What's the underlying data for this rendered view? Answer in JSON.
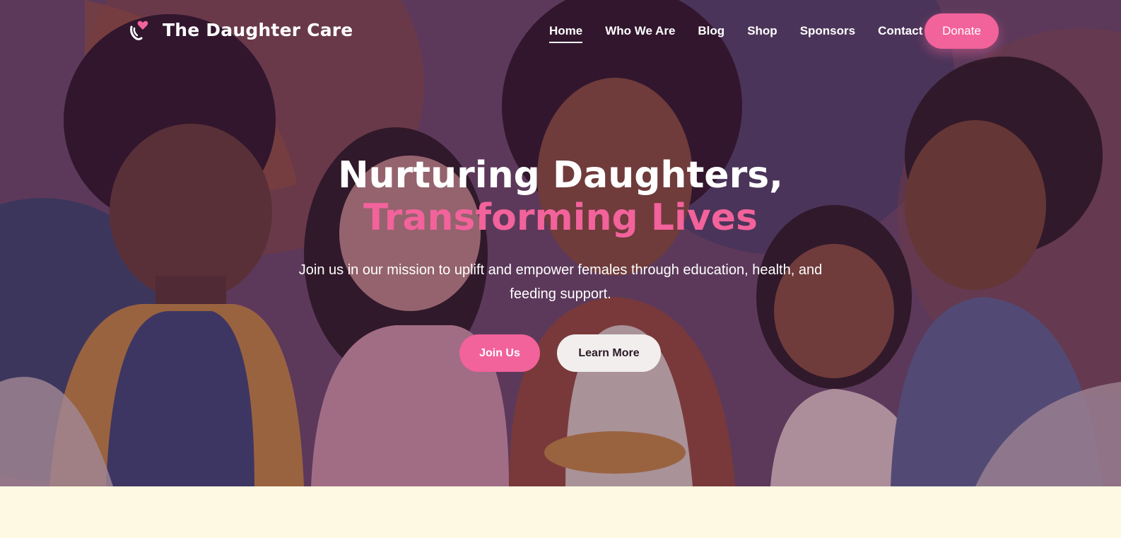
{
  "brand": {
    "name": "The Daughter Care",
    "icon": "hands-heart-icon"
  },
  "nav": {
    "items": [
      {
        "label": "Home",
        "active": true
      },
      {
        "label": "Who We Are",
        "active": false
      },
      {
        "label": "Blog",
        "active": false
      },
      {
        "label": "Shop",
        "active": false
      },
      {
        "label": "Sponsors",
        "active": false
      },
      {
        "label": "Contact",
        "active": false
      }
    ],
    "donate_label": "Donate"
  },
  "hero": {
    "title_line1": "Nurturing Daughters,",
    "title_line2": "Transforming Lives",
    "subtitle": "Join us in our mission to uplift and empower females through education, health, and feeding support.",
    "primary_button": "Join Us",
    "secondary_button": "Learn More"
  },
  "colors": {
    "accent": "#f2629b",
    "light_button": "#f2eeee",
    "section_bg": "#fdf8e1"
  }
}
